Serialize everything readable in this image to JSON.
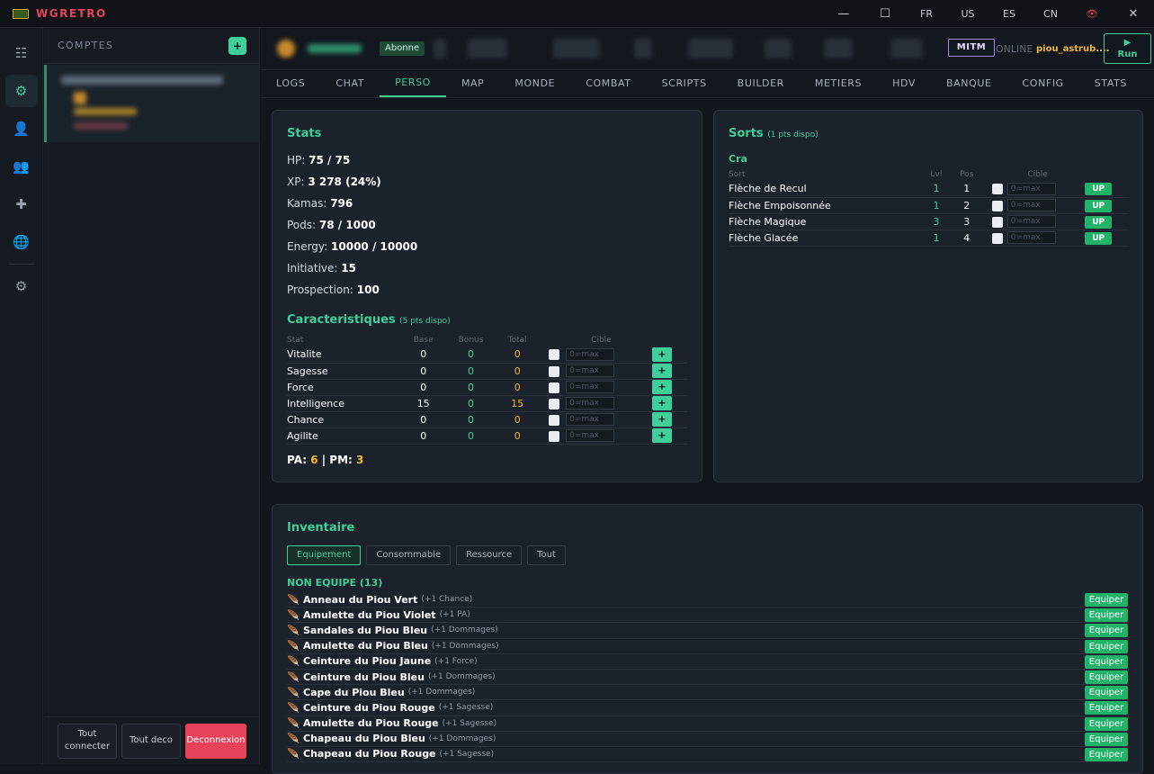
{
  "app": {
    "title": "WGRETRO"
  },
  "window_controls": [
    "—",
    "☐",
    "FR",
    "US",
    "ES",
    "CN",
    "✕"
  ],
  "rail_icons": [
    "list-icon",
    "gear-icon",
    "character-icon",
    "group-icon",
    "cross-icon",
    "globe-icon",
    "settings-icon"
  ],
  "accounts": {
    "header": "COMPTES",
    "add_label": "+",
    "footer": {
      "connect_all": "Tout connecter",
      "disconnect_all": "Tout deco",
      "logout": "Deconnexion"
    }
  },
  "charbar": {
    "badge": "Abonne",
    "mitm": "MITM",
    "status": "ONLINE",
    "char_id": "piou_astrub....",
    "run": "Run",
    "run_icon": "▶"
  },
  "tabs": [
    "LOGS",
    "CHAT",
    "PERSO",
    "MAP",
    "MONDE",
    "COMBAT",
    "SCRIPTS",
    "BUILDER",
    "METIERS",
    "HDV",
    "BANQUE",
    "CONFIG",
    "STATS"
  ],
  "active_tab": "PERSO",
  "stats": {
    "title": "Stats",
    "lines": [
      {
        "label": "HP:",
        "value": "75 / 75"
      },
      {
        "label": "XP:",
        "value": "3 278 (24%)"
      },
      {
        "label": "Kamas:",
        "value": "796"
      },
      {
        "label": "Pods:",
        "value": "78 / 1000"
      },
      {
        "label": "Energy:",
        "value": "10000 / 10000"
      },
      {
        "label": "Initiative:",
        "value": "15"
      },
      {
        "label": "Prospection:",
        "value": "100"
      }
    ]
  },
  "caracteristiques": {
    "title": "Caracteristiques",
    "subtitle": "(5 pts dispo)",
    "headers": [
      "Stat",
      "Base",
      "Bonus",
      "Total",
      "Cible"
    ],
    "placeholder": "0=max",
    "rows": [
      {
        "name": "Vitalite",
        "base": "0",
        "bonus": "0",
        "total": "0"
      },
      {
        "name": "Sagesse",
        "base": "0",
        "bonus": "0",
        "total": "0"
      },
      {
        "name": "Force",
        "base": "0",
        "bonus": "0",
        "total": "0"
      },
      {
        "name": "Intelligence",
        "base": "15",
        "bonus": "0",
        "total": "15"
      },
      {
        "name": "Chance",
        "base": "0",
        "bonus": "0",
        "total": "0"
      },
      {
        "name": "Agilite",
        "base": "0",
        "bonus": "0",
        "total": "0"
      }
    ],
    "pa_label": "PA:",
    "pa": "6",
    "pm_label": "| PM:",
    "pm": "3"
  },
  "sorts": {
    "title": "Sorts",
    "subtitle": "(1 pts dispo)",
    "class": "Cra",
    "headers": [
      "Sort",
      "Lvl",
      "Pos",
      "Cible"
    ],
    "placeholder": "0=max",
    "up_label": "UP",
    "rows": [
      {
        "name": "Flèche de Recul",
        "lvl": "1",
        "pos": "1"
      },
      {
        "name": "Flèche Empoisonnée",
        "lvl": "1",
        "pos": "2"
      },
      {
        "name": "Flèche Magique",
        "lvl": "3",
        "pos": "3"
      },
      {
        "name": "Flèche Glacée",
        "lvl": "1",
        "pos": "4"
      }
    ]
  },
  "inventaire": {
    "title": "Inventaire",
    "tabs": [
      "Equipement",
      "Consommable",
      "Ressource",
      "Tout"
    ],
    "active_tab": "Equipement",
    "section": "NON EQUIPE (13)",
    "equip_label": "Equiper",
    "items": [
      {
        "name": "Anneau du Piou Vert",
        "bonus": "(+1 Chance)"
      },
      {
        "name": "Amulette du Piou Violet",
        "bonus": "(+1 PA)"
      },
      {
        "name": "Sandales du Piou Bleu",
        "bonus": "(+1 Dommages)"
      },
      {
        "name": "Amulette du Piou Bleu",
        "bonus": "(+1 Dommages)"
      },
      {
        "name": "Ceinture du Piou Jaune",
        "bonus": "(+1 Force)"
      },
      {
        "name": "Ceinture du Piou Bleu",
        "bonus": "(+1 Dommages)"
      },
      {
        "name": "Cape du Piou Bleu",
        "bonus": "(+1 Dommages)"
      },
      {
        "name": "Ceinture du Piou Rouge",
        "bonus": "(+1 Sagesse)"
      },
      {
        "name": "Amulette du Piou Rouge",
        "bonus": "(+1 Sagesse)"
      },
      {
        "name": "Chapeau du Piou Bleu",
        "bonus": "(+1 Dommages)"
      },
      {
        "name": "Chapeau du Piou Rouge",
        "bonus": "(+1 Sagesse)"
      }
    ]
  },
  "colors": {
    "accent": "#3ecf9b",
    "danger": "#e9435c",
    "gold": "#f1b736",
    "equip": "#22b36a"
  }
}
